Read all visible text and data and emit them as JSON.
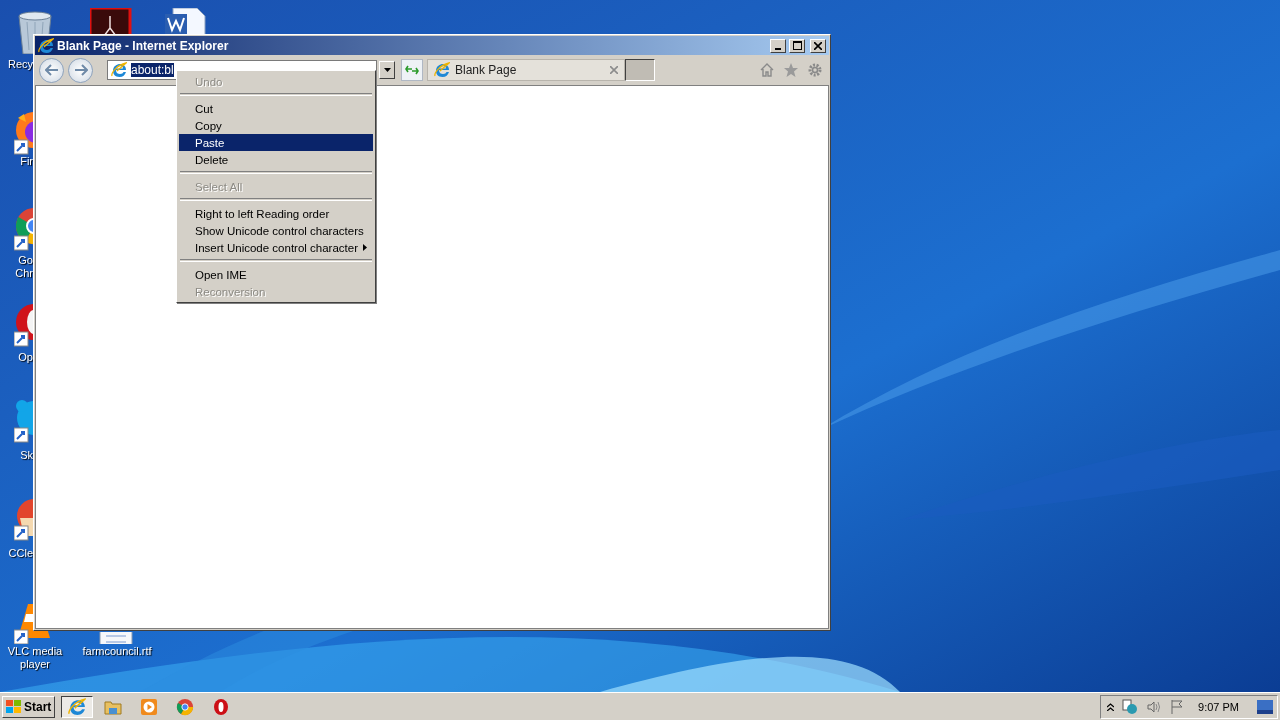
{
  "desktop": {
    "icons": [
      {
        "kind": "recycle",
        "label": "Recy"
      },
      {
        "kind": "acrobat"
      },
      {
        "kind": "word"
      },
      {
        "kind": "firefox",
        "label": "Fir"
      },
      {
        "kind": "chrome",
        "label": "Go Chr"
      },
      {
        "kind": "opera",
        "label": "Op"
      },
      {
        "kind": "skype",
        "label": "Sk"
      },
      {
        "kind": "ccleaner",
        "label": "CCle"
      },
      {
        "kind": "vlc",
        "label": "VLC media player"
      },
      {
        "kind": "document",
        "label": "farmcouncil.rtf"
      }
    ]
  },
  "window": {
    "title": "Blank Page - Internet Explorer",
    "address": "about:bl",
    "tab": {
      "title": "Blank Page",
      "selected": true
    }
  },
  "context_menu": {
    "items": [
      {
        "kind": "item",
        "label": "Undo",
        "disabled": true,
        "selected": false
      },
      {
        "kind": "separator"
      },
      {
        "kind": "item",
        "label": "Cut",
        "disabled": false,
        "selected": false
      },
      {
        "kind": "item",
        "label": "Copy",
        "disabled": false,
        "selected": false
      },
      {
        "kind": "item",
        "label": "Paste",
        "disabled": false,
        "selected": true
      },
      {
        "kind": "item",
        "label": "Delete",
        "disabled": false,
        "selected": false
      },
      {
        "kind": "separator"
      },
      {
        "kind": "item",
        "label": "Select All",
        "disabled": true,
        "selected": false
      },
      {
        "kind": "separator"
      },
      {
        "kind": "item",
        "label": "Right to left Reading order",
        "disabled": false,
        "selected": false
      },
      {
        "kind": "item",
        "label": "Show Unicode control characters",
        "disabled": false,
        "selected": false
      },
      {
        "kind": "submenu",
        "label": "Insert Unicode control character",
        "disabled": false,
        "selected": false
      },
      {
        "kind": "separator"
      },
      {
        "kind": "item",
        "label": "Open IME",
        "disabled": false,
        "selected": false
      },
      {
        "kind": "item",
        "label": "Reconversion",
        "disabled": true,
        "selected": false
      }
    ]
  },
  "taskbar": {
    "start": "Start",
    "apps": [
      {
        "kind": "ie",
        "active": true
      },
      {
        "kind": "explorer",
        "active": false
      },
      {
        "kind": "media",
        "active": false
      },
      {
        "kind": "chrome",
        "active": false
      },
      {
        "kind": "opera",
        "active": false
      }
    ],
    "clock": "9:07 PM"
  }
}
